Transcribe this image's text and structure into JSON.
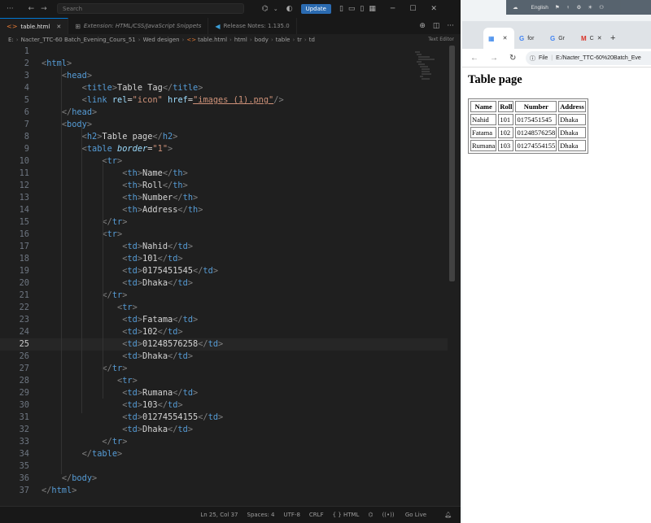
{
  "titlebar": {
    "search_placeholder": "Search",
    "update_label": "Update"
  },
  "tabs": [
    {
      "label": "table.html",
      "icon": "html-icon"
    },
    {
      "label": "Extension: HTML/CSS/JavaScript Snippets",
      "icon": "extension-icon"
    },
    {
      "label": "Release Notes: 1.135.0",
      "icon": "vscode-icon"
    }
  ],
  "breadcrumb": [
    "E:",
    "Nacter_TTC-60 Batch_Evening_Cours_51",
    "Wed desigen",
    "table.html",
    "html",
    "body",
    "table",
    "tr",
    "td"
  ],
  "text_editor_label": "Text Editor",
  "code_lines": [
    "",
    "<html>",
    "    <head>",
    "        <title>Table Tag</title>",
    "        <link rel=\"icon\" href=\"images (1).png\"/>",
    "    </head>",
    "    <body>",
    "        <h2>Table page</h2>",
    "        <table border=\"1\">",
    "            <tr>",
    "                <th>Name</th>",
    "                <th>Roll</th>",
    "                <th>Number</th>",
    "                <th>Address</th>",
    "            </tr>",
    "            <tr>",
    "                <td>Nahid</td>",
    "                <td>101</td>",
    "                <td>0175451545</td>",
    "                <td>Dhaka</td>",
    "            </tr>",
    "               <tr>",
    "                <td>Fatama</td>",
    "                <td>102</td>",
    "                <td>01248576258</td>",
    "                <td>Dhaka</td>",
    "            </tr>",
    "               <tr>",
    "                <td>Rumana</td>",
    "                <td>103</td>",
    "                <td>01274554155</td>",
    "                <td>Dhaka</td>",
    "            </tr>",
    "        </table>",
    "",
    "    </body>",
    "</html>"
  ],
  "current_line": 25,
  "statusbar": {
    "position": "Ln 25, Col 37",
    "spaces": "Spaces: 4",
    "encoding": "UTF-8",
    "eol": "CRLF",
    "language": "{ } HTML",
    "golive": "Go Live"
  },
  "chrome": {
    "tabs": [
      {
        "label": "",
        "icon": "page-icon"
      },
      {
        "label": "for",
        "icon": "google-icon"
      },
      {
        "label": "Gr",
        "icon": "google-icon"
      },
      {
        "label": "C",
        "icon": "gmail-icon"
      }
    ],
    "file_label": "File",
    "url": "E:/Nacter_TTC-60%20Batch_Eve",
    "page": {
      "heading": "Table page",
      "headers": [
        "Name",
        "Roll",
        "Number",
        "Address"
      ],
      "rows": [
        [
          "Nahid",
          "101",
          "0175451545",
          "Dhaka"
        ],
        [
          "Fatama",
          "102",
          "01248576258",
          "Dhaka"
        ],
        [
          "Rumana",
          "103",
          "01274554155",
          "Dhaka"
        ]
      ]
    }
  },
  "tray": {
    "language": "English"
  }
}
